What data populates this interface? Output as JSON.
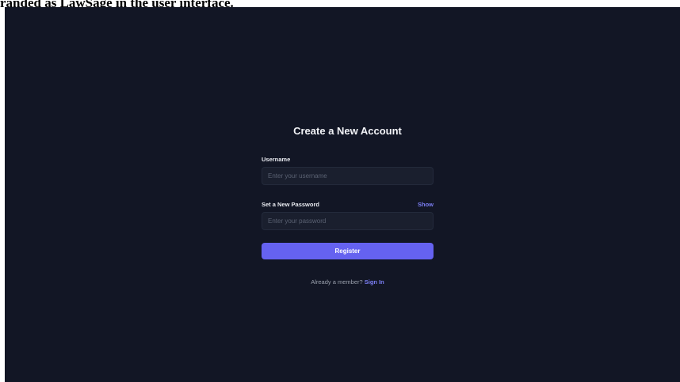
{
  "caption": "randed as LawSage in the user interface.",
  "form": {
    "title": "Create a New Account",
    "username_label": "Username",
    "username_placeholder": "Enter your username",
    "password_label": "Set a New Password",
    "show_label": "Show",
    "password_placeholder": "Enter your password",
    "register_label": "Register",
    "member_text": "Already a member?",
    "signin_label": "Sign In"
  }
}
